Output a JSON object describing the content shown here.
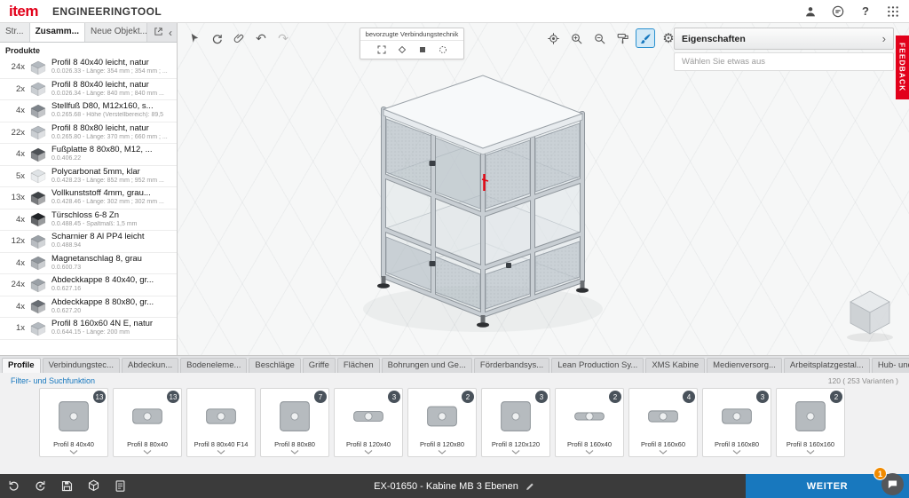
{
  "colors": {
    "brand_red": "#e2001a",
    "accent_blue": "#1878be",
    "badge_dark": "#49525b",
    "notification_orange": "#f08a00"
  },
  "header": {
    "logo": "item",
    "title": "ENGINEERINGTOOL",
    "help_label": "?"
  },
  "left_panel": {
    "tabs": [
      {
        "label": "Str..."
      },
      {
        "label": "Zusamm...",
        "active": true
      },
      {
        "label": "Neue Objekt..."
      }
    ],
    "section_title": "Produkte",
    "products": [
      {
        "qty": "24x",
        "name": "Profil 8 40x40 leicht, natur",
        "details": "0.0.026.33 - Länge: 354 mm ; 354 mm ; ...",
        "thumb_color": "#b4bac0"
      },
      {
        "qty": "2x",
        "name": "Profil 8 80x40 leicht, natur",
        "details": "0.0.026.34 - Länge: 840 mm ; 840 mm ...",
        "thumb_color": "#b4bac0"
      },
      {
        "qty": "4x",
        "name": "Stellfuß D80, M12x160, s...",
        "details": "0.0.265.68 - Höhe (Verstellbereich): 89,5",
        "thumb_color": "#7d838a"
      },
      {
        "qty": "22x",
        "name": "Profil 8 80x80 leicht, natur",
        "details": "0.0.265.80 - Länge: 370 mm ; 660 mm ; ...",
        "thumb_color": "#b4bac0"
      },
      {
        "qty": "4x",
        "name": "Fußplatte 8 80x80, M12, ...",
        "details": "0.0.406.22",
        "thumb_color": "#4d5156"
      },
      {
        "qty": "5x",
        "name": "Polycarbonat 5mm, klar",
        "details": "0.0.428.23 - Länge: 852 mm ; 952 mm ...",
        "thumb_color": "#dfe3e6"
      },
      {
        "qty": "13x",
        "name": "Vollkunststoff 4mm, grau...",
        "details": "0.0.428.46 - Länge: 302 mm ; 302 mm ...",
        "thumb_color": "#3f4347"
      },
      {
        "qty": "4x",
        "name": "Türschloss 6-8 Zn",
        "details": "0.0.488.45 - Spaltmaß: 1,5 mm",
        "thumb_color": "#202327"
      },
      {
        "qty": "12x",
        "name": "Scharnier 8 Al PP4 leicht",
        "details": "0.0.488.94",
        "thumb_color": "#9ba1a7"
      },
      {
        "qty": "4x",
        "name": "Magnetanschlag 8, grau",
        "details": "0.0.600.73",
        "thumb_color": "#8e949a"
      },
      {
        "qty": "24x",
        "name": "Abdeckkappe 8 40x40, gr...",
        "details": "0.0.627.16",
        "thumb_color": "#9aa0a6"
      },
      {
        "qty": "4x",
        "name": "Abdeckkappe 8 80x80, gr...",
        "details": "0.0.627.20",
        "thumb_color": "#686d73"
      },
      {
        "qty": "1x",
        "name": "Profil 8 160x60 4N E, natur",
        "details": "0.0.644.15 - Länge: 200 mm",
        "thumb_color": "#b4bac0"
      }
    ]
  },
  "toolbar": {
    "connection_label": "bevorzugte Verbindungstechnik",
    "undo_glyph": "↶",
    "redo_glyph": "↷",
    "gear_glyph": "⚙"
  },
  "properties": {
    "title": "Eigenschaften",
    "empty_text": "Wählen Sie etwas aus",
    "chevron": "›"
  },
  "feedback_tab": "FEEDBACK",
  "catalog": {
    "tabs": [
      {
        "label": "Profile",
        "active": true
      },
      {
        "label": "Verbindungstec..."
      },
      {
        "label": "Abdeckun..."
      },
      {
        "label": "Bodeneleme..."
      },
      {
        "label": "Beschläge"
      },
      {
        "label": "Griffe"
      },
      {
        "label": "Flächen"
      },
      {
        "label": "Bohrungen und Ge..."
      },
      {
        "label": "Förderbandsys..."
      },
      {
        "label": "Lean Production Sy..."
      },
      {
        "label": "XMS Kabine"
      },
      {
        "label": "Medienversorg..."
      },
      {
        "label": "Arbeitsplatzgestal..."
      },
      {
        "label": "Hub- und Transportte..."
      }
    ],
    "filter_link": "Filter- und Suchfunktion",
    "count_text": "120 ( 253 Varianten )",
    "items": [
      {
        "name": "Profil 8 40x40",
        "badge": "13"
      },
      {
        "name": "Profil 8 80x40",
        "badge": "13"
      },
      {
        "name": "Profil 8 80x40 F14"
      },
      {
        "name": "Profil 8 80x80",
        "badge": "7"
      },
      {
        "name": "Profil 8 120x40",
        "badge": "3"
      },
      {
        "name": "Profil 8 120x80",
        "badge": "2"
      },
      {
        "name": "Profil 8 120x120",
        "badge": "3"
      },
      {
        "name": "Profil 8 160x40",
        "badge": "2"
      },
      {
        "name": "Profil 8 160x60",
        "badge": "4"
      },
      {
        "name": "Profil 8 160x80",
        "badge": "3"
      },
      {
        "name": "Profil 8 160x160",
        "badge": "2"
      }
    ]
  },
  "bottom_bar": {
    "project_name": "EX-01650 - Kabine MB 3 Ebenen",
    "next_label": "WEITER",
    "next_chevron": "›",
    "notification_count": "1"
  }
}
